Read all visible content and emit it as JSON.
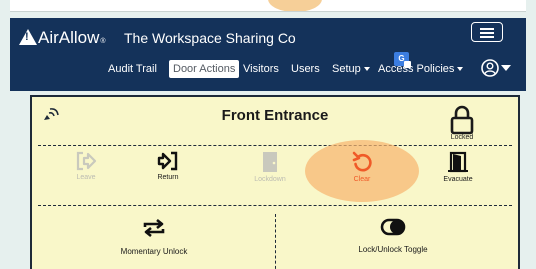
{
  "brand": {
    "name": "AirAllow",
    "trademark": "®"
  },
  "company": "The Workspace Sharing Co",
  "nav": [
    {
      "label": "Audit Trail"
    },
    {
      "label": "Door Actions",
      "active": true
    },
    {
      "label": "Visitors"
    },
    {
      "label": "Users"
    },
    {
      "label": "Setup"
    },
    {
      "label": "Access Policies"
    }
  ],
  "door": {
    "title": "Front Entrance",
    "status_label": "Locked",
    "actions": [
      {
        "label": "Leave",
        "icon": "leave-icon",
        "enabled": false
      },
      {
        "label": "Return",
        "icon": "return-icon",
        "enabled": true
      },
      {
        "label": "Lockdown",
        "icon": "lockdown-icon",
        "enabled": false
      },
      {
        "label": "Clear",
        "icon": "clear-icon",
        "enabled": true,
        "highlighted": true
      },
      {
        "label": "Evacuate",
        "icon": "evacuate-icon",
        "enabled": true
      }
    ],
    "secondary_actions": [
      {
        "label": "Momentary Unlock",
        "icon": "momentary-unlock-icon"
      },
      {
        "label": "Lock/Unlock Toggle",
        "icon": "toggle-icon"
      }
    ]
  },
  "colors": {
    "nav_bg": "#14325a",
    "card_bg": "#f9f7c9",
    "accent": "#f05a28",
    "highlight": "#f6b570"
  }
}
